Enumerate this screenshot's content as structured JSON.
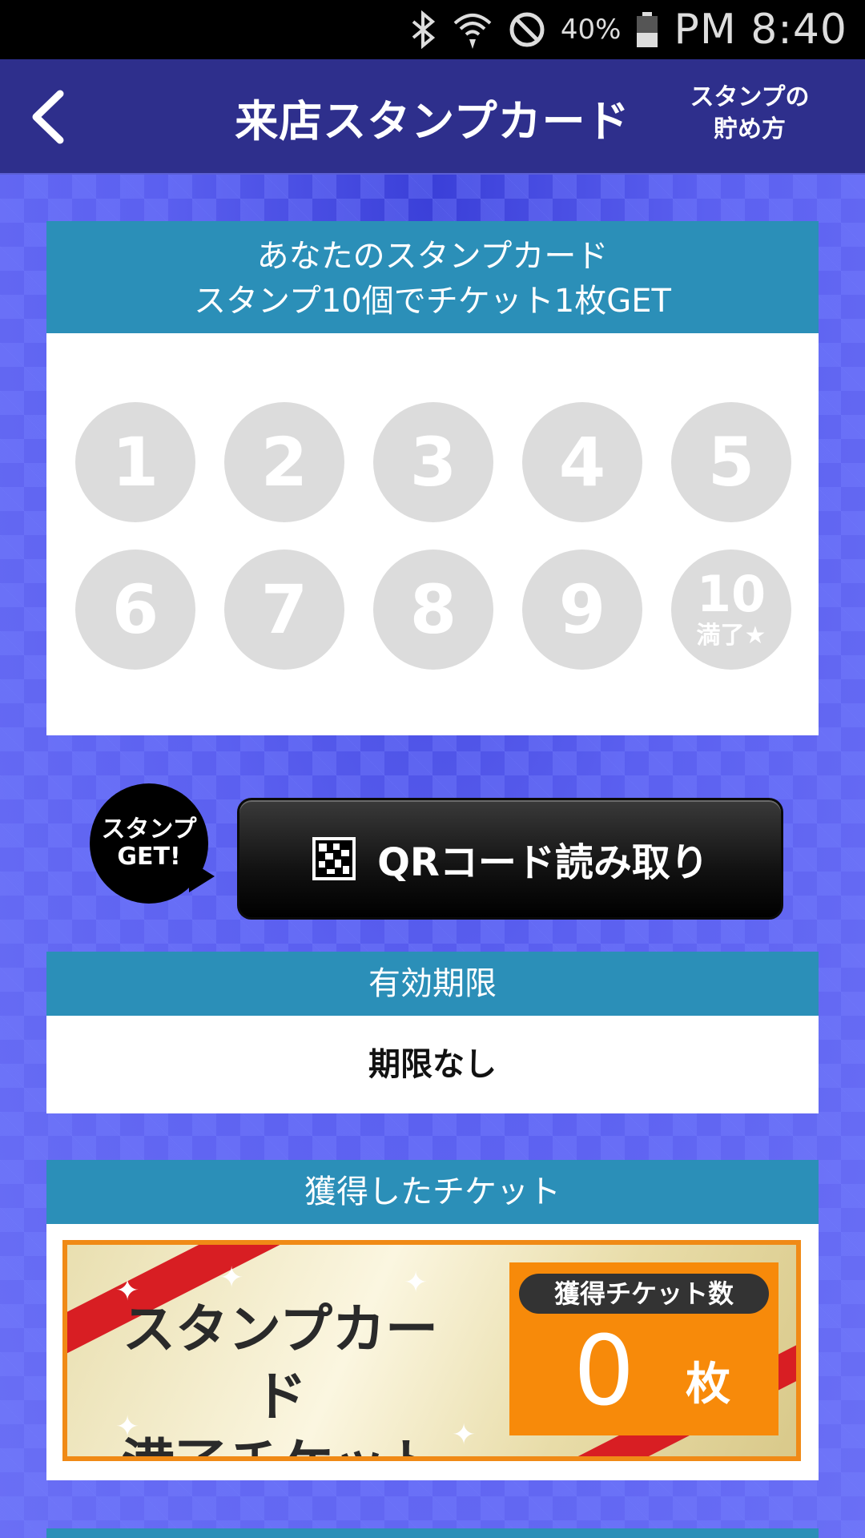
{
  "status_bar": {
    "battery_percent": "40%",
    "time": "PM 8:40"
  },
  "header": {
    "title": "来店スタンプカード",
    "howto_line1": "スタンプの",
    "howto_line2": "貯め方"
  },
  "stamp_card": {
    "heading_line1": "あなたのスタンプカード",
    "heading_line2": "スタンプ10個でチケット1枚GET",
    "stamps": [
      {
        "num": "1"
      },
      {
        "num": "2"
      },
      {
        "num": "3"
      },
      {
        "num": "4"
      },
      {
        "num": "5"
      },
      {
        "num": "6"
      },
      {
        "num": "7"
      },
      {
        "num": "8"
      },
      {
        "num": "9"
      },
      {
        "num": "10",
        "sub": "満了★"
      }
    ],
    "stamped_count": 0
  },
  "qr": {
    "bubble_line1": "スタンプ",
    "bubble_line2": "GET!",
    "button_label": "QRコード読み取り"
  },
  "expiry": {
    "heading": "有効期限",
    "value": "期限なし"
  },
  "tickets": {
    "heading": "獲得したチケット",
    "ticket_line1": "スタンプカード",
    "ticket_line2": "満了チケット",
    "count_label": "獲得チケット数",
    "count": "0",
    "unit": "枚"
  },
  "colors": {
    "header_bg": "#2e2f8c",
    "panel_head": "#2b8fb8",
    "stamp_empty": "#dcdcdc",
    "ticket_orange": "#f78a0a",
    "ribbon_red": "#d81e23"
  }
}
